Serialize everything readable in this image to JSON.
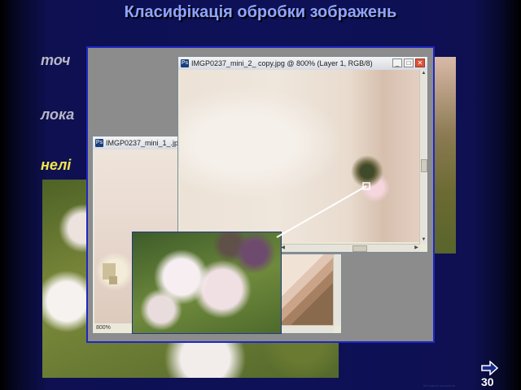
{
  "slide": {
    "title": "Класифікація обробки зображень",
    "bullets": [
      {
        "mark": "",
        "text": "точ"
      },
      {
        "mark": "",
        "text": "лока"
      },
      {
        "mark": "",
        "text": "нелі"
      }
    ],
    "page_number": "30",
    "footer_text": "Методичні матеріали"
  },
  "windows": {
    "main": {
      "title": "IMGP0237_mini_2_ copy.jpg @ 800% (Layer 1, RGB/8)",
      "minimize": "_",
      "maximize": "□",
      "close": "✕"
    },
    "small": {
      "title": "IMGP0237_mini_1_.jpg",
      "zoom": "800%"
    }
  },
  "colors": {
    "title": "#8fa4ff",
    "highlight_bullet": "#f2e64a",
    "panel_border": "#1f27c4"
  },
  "icons": {
    "app": "photoshop-icon",
    "nav": "next-slide-arrow-icon"
  }
}
